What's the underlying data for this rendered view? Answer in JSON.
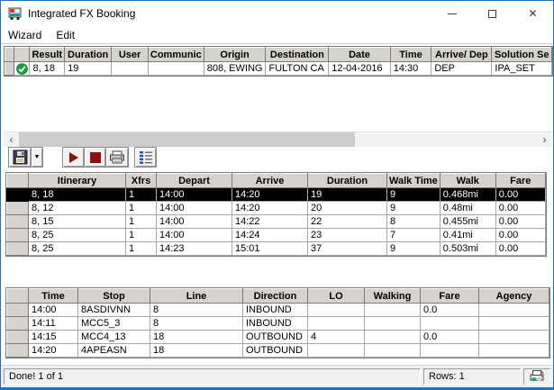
{
  "window": {
    "title": "Integrated FX Booking"
  },
  "menu": {
    "items": [
      "Wizard",
      "Edit"
    ]
  },
  "icons": {
    "close": "✕",
    "scroll_left": "‹",
    "scroll_right": "›",
    "dropdown": "▼"
  },
  "solution_table": {
    "headers": [
      "Result",
      "Duration",
      "User",
      "Communic",
      "Origin",
      "Destination",
      "Date",
      "Time",
      "Arrive/ Dep",
      "Solution Se"
    ],
    "row": {
      "status_icon": "green-check",
      "cells": [
        "8, 18",
        "19",
        "",
        "",
        "808, EWING",
        "FULTON CA",
        "12-04-2016",
        "14:30",
        "DEP",
        "IPA_SET"
      ]
    }
  },
  "itinerary_table": {
    "headers": [
      "Itinerary",
      "Xfrs",
      "Depart",
      "Arrive",
      "Duration",
      "Walk Time",
      "Walk",
      "Fare"
    ],
    "selected_row_index": 0,
    "rows": [
      [
        "8, 18",
        "1",
        "14:00",
        "14:20",
        "19",
        "9",
        "0.468mi",
        "0.00"
      ],
      [
        "8, 12",
        "1",
        "14:00",
        "14:20",
        "20",
        "9",
        "0.48mi",
        "0.00"
      ],
      [
        "8, 15",
        "1",
        "14:00",
        "14:22",
        "22",
        "8",
        "0.455mi",
        "0.00"
      ],
      [
        "8, 25",
        "1",
        "14:00",
        "14:24",
        "23",
        "7",
        "0.41mi",
        "0.00"
      ],
      [
        "8, 25",
        "1",
        "14:23",
        "15:01",
        "37",
        "9",
        "0.503mi",
        "0.00"
      ]
    ]
  },
  "stops_table": {
    "headers": [
      "Time",
      "Stop",
      "Line",
      "Direction",
      "LO",
      "Walking",
      "Fare",
      "Agency"
    ],
    "rows": [
      [
        "14:00",
        "8ASDIVNN",
        "8",
        "INBOUND",
        "",
        "",
        "0.0",
        ""
      ],
      [
        "14:11",
        "MCC5_3",
        "8",
        "INBOUND",
        "",
        "",
        "",
        ""
      ],
      [
        "14:15",
        "MCC4_13",
        "18",
        "OUTBOUND",
        "4",
        "",
        "0.0",
        ""
      ],
      [
        "14:20",
        "4APEASN",
        "18",
        "OUTBOUND",
        "",
        "",
        "",
        ""
      ]
    ]
  },
  "status_bar": {
    "message": "Done! 1 of 1",
    "rows": "Rows: 1"
  },
  "toolbar": {
    "buttons": [
      "save",
      "save-dropdown",
      "run",
      "stop",
      "print",
      "details"
    ]
  },
  "colors": {
    "window_border": "#1d74c4",
    "selection_bg": "#000000",
    "selection_text": "#ffffff",
    "check_green": "#1a9c40",
    "toolbar_red": "#8f1010",
    "header_bg": "#d6d3ce"
  }
}
